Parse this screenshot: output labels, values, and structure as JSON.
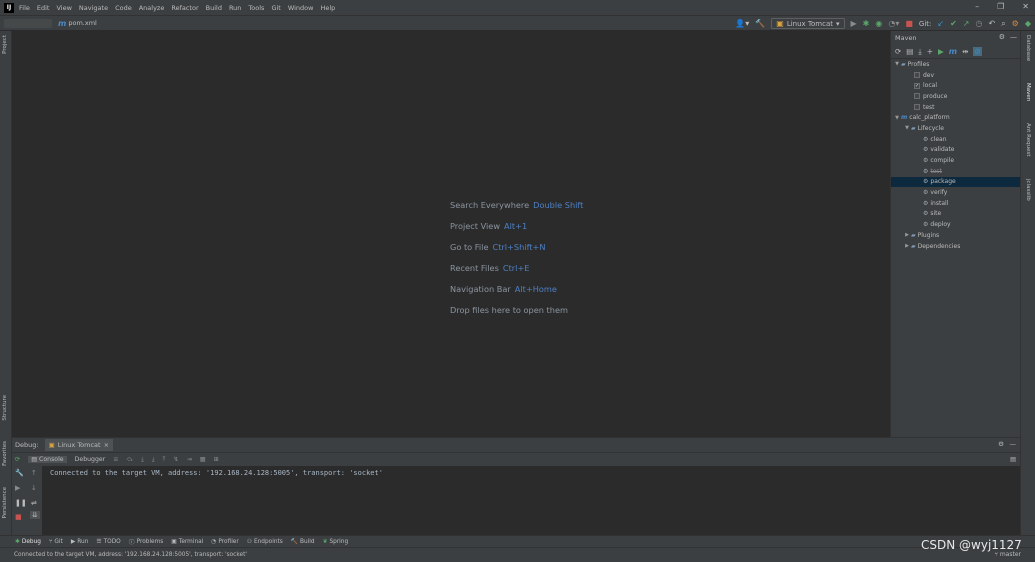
{
  "menubar": {
    "logo": "IJ",
    "items": [
      "File",
      "Edit",
      "View",
      "Navigate",
      "Code",
      "Analyze",
      "Refactor",
      "Build",
      "Run",
      "Tools",
      "Git",
      "Window",
      "Help"
    ]
  },
  "toolbar": {
    "file_tab": "pom.xml",
    "run_config": "Linux Tomcat",
    "git_label": "Git:"
  },
  "left_strip": {
    "project": "Project",
    "structure": "Structure",
    "favorites": "Favorites",
    "persistence": "Persistence"
  },
  "right_strip": {
    "database": "Database",
    "maven": "Maven",
    "ant_request": "Ant Request",
    "jclasslib": "jclasslib"
  },
  "editor": {
    "hints": [
      {
        "text": "Search Everywhere",
        "key": "Double Shift"
      },
      {
        "text": "Project View",
        "key": "Alt+1"
      },
      {
        "text": "Go to File",
        "key": "Ctrl+Shift+N"
      },
      {
        "text": "Recent Files",
        "key": "Ctrl+E"
      },
      {
        "text": "Navigation Bar",
        "key": "Alt+Home"
      },
      {
        "text": "Drop files here to open them",
        "key": ""
      }
    ]
  },
  "maven": {
    "title": "Maven",
    "profiles_label": "Profiles",
    "profiles": [
      {
        "name": "dev",
        "checked": false
      },
      {
        "name": "local",
        "checked": true
      },
      {
        "name": "produce",
        "checked": false
      },
      {
        "name": "test",
        "checked": false
      }
    ],
    "project": "calc_platform",
    "lifecycle_label": "Lifecycle",
    "lifecycle": [
      "clean",
      "validate",
      "compile",
      "test",
      "package",
      "verify",
      "install",
      "site",
      "deploy"
    ],
    "selected": "package",
    "plugins_label": "Plugins",
    "dependencies_label": "Dependencies"
  },
  "debug": {
    "label": "Debug:",
    "session_tab": "Linux Tomcat",
    "console_tab": "Console",
    "debugger_tab": "Debugger",
    "console_output": "Connected to the target VM, address: '192.168.24.128:5005', transport: 'socket'"
  },
  "bottom_bar": {
    "items": [
      "Debug",
      "Git",
      "Run",
      "TODO",
      "Problems",
      "Terminal",
      "Profiler",
      "Endpoints",
      "Build",
      "Spring"
    ]
  },
  "status_bar": {
    "message": "Connected to the target VM, address: '192.168.24.128:5005', transport: 'socket'",
    "branch": "master"
  },
  "watermark": "CSDN @wyj1127"
}
